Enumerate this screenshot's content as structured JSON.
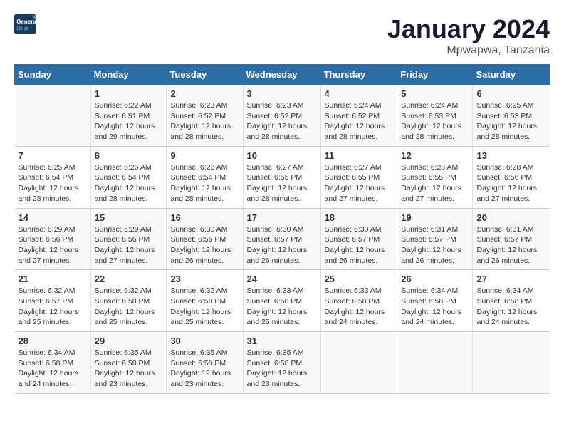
{
  "logo": {
    "line1": "General",
    "line2": "Blue"
  },
  "title": "January 2024",
  "subtitle": "Mpwapwa, Tanzania",
  "days_of_week": [
    "Sunday",
    "Monday",
    "Tuesday",
    "Wednesday",
    "Thursday",
    "Friday",
    "Saturday"
  ],
  "weeks": [
    [
      {
        "num": "",
        "sunrise": "",
        "sunset": "",
        "daylight": ""
      },
      {
        "num": "1",
        "sunrise": "Sunrise: 6:22 AM",
        "sunset": "Sunset: 6:51 PM",
        "daylight": "Daylight: 12 hours and 29 minutes."
      },
      {
        "num": "2",
        "sunrise": "Sunrise: 6:23 AM",
        "sunset": "Sunset: 6:52 PM",
        "daylight": "Daylight: 12 hours and 28 minutes."
      },
      {
        "num": "3",
        "sunrise": "Sunrise: 6:23 AM",
        "sunset": "Sunset: 6:52 PM",
        "daylight": "Daylight: 12 hours and 28 minutes."
      },
      {
        "num": "4",
        "sunrise": "Sunrise: 6:24 AM",
        "sunset": "Sunset: 6:52 PM",
        "daylight": "Daylight: 12 hours and 28 minutes."
      },
      {
        "num": "5",
        "sunrise": "Sunrise: 6:24 AM",
        "sunset": "Sunset: 6:53 PM",
        "daylight": "Daylight: 12 hours and 28 minutes."
      },
      {
        "num": "6",
        "sunrise": "Sunrise: 6:25 AM",
        "sunset": "Sunset: 6:53 PM",
        "daylight": "Daylight: 12 hours and 28 minutes."
      }
    ],
    [
      {
        "num": "7",
        "sunrise": "Sunrise: 6:25 AM",
        "sunset": "Sunset: 6:54 PM",
        "daylight": "Daylight: 12 hours and 28 minutes."
      },
      {
        "num": "8",
        "sunrise": "Sunrise: 6:26 AM",
        "sunset": "Sunset: 6:54 PM",
        "daylight": "Daylight: 12 hours and 28 minutes."
      },
      {
        "num": "9",
        "sunrise": "Sunrise: 6:26 AM",
        "sunset": "Sunset: 6:54 PM",
        "daylight": "Daylight: 12 hours and 28 minutes."
      },
      {
        "num": "10",
        "sunrise": "Sunrise: 6:27 AM",
        "sunset": "Sunset: 6:55 PM",
        "daylight": "Daylight: 12 hours and 28 minutes."
      },
      {
        "num": "11",
        "sunrise": "Sunrise: 6:27 AM",
        "sunset": "Sunset: 6:55 PM",
        "daylight": "Daylight: 12 hours and 27 minutes."
      },
      {
        "num": "12",
        "sunrise": "Sunrise: 6:28 AM",
        "sunset": "Sunset: 6:55 PM",
        "daylight": "Daylight: 12 hours and 27 minutes."
      },
      {
        "num": "13",
        "sunrise": "Sunrise: 6:28 AM",
        "sunset": "Sunset: 6:56 PM",
        "daylight": "Daylight: 12 hours and 27 minutes."
      }
    ],
    [
      {
        "num": "14",
        "sunrise": "Sunrise: 6:29 AM",
        "sunset": "Sunset: 6:56 PM",
        "daylight": "Daylight: 12 hours and 27 minutes."
      },
      {
        "num": "15",
        "sunrise": "Sunrise: 6:29 AM",
        "sunset": "Sunset: 6:56 PM",
        "daylight": "Daylight: 12 hours and 27 minutes."
      },
      {
        "num": "16",
        "sunrise": "Sunrise: 6:30 AM",
        "sunset": "Sunset: 6:56 PM",
        "daylight": "Daylight: 12 hours and 26 minutes."
      },
      {
        "num": "17",
        "sunrise": "Sunrise: 6:30 AM",
        "sunset": "Sunset: 6:57 PM",
        "daylight": "Daylight: 12 hours and 26 minutes."
      },
      {
        "num": "18",
        "sunrise": "Sunrise: 6:30 AM",
        "sunset": "Sunset: 6:57 PM",
        "daylight": "Daylight: 12 hours and 26 minutes."
      },
      {
        "num": "19",
        "sunrise": "Sunrise: 6:31 AM",
        "sunset": "Sunset: 6:57 PM",
        "daylight": "Daylight: 12 hours and 26 minutes."
      },
      {
        "num": "20",
        "sunrise": "Sunrise: 6:31 AM",
        "sunset": "Sunset: 6:57 PM",
        "daylight": "Daylight: 12 hours and 26 minutes."
      }
    ],
    [
      {
        "num": "21",
        "sunrise": "Sunrise: 6:32 AM",
        "sunset": "Sunset: 6:57 PM",
        "daylight": "Daylight: 12 hours and 25 minutes."
      },
      {
        "num": "22",
        "sunrise": "Sunrise: 6:32 AM",
        "sunset": "Sunset: 6:58 PM",
        "daylight": "Daylight: 12 hours and 25 minutes."
      },
      {
        "num": "23",
        "sunrise": "Sunrise: 6:32 AM",
        "sunset": "Sunset: 6:58 PM",
        "daylight": "Daylight: 12 hours and 25 minutes."
      },
      {
        "num": "24",
        "sunrise": "Sunrise: 6:33 AM",
        "sunset": "Sunset: 6:58 PM",
        "daylight": "Daylight: 12 hours and 25 minutes."
      },
      {
        "num": "25",
        "sunrise": "Sunrise: 6:33 AM",
        "sunset": "Sunset: 6:58 PM",
        "daylight": "Daylight: 12 hours and 24 minutes."
      },
      {
        "num": "26",
        "sunrise": "Sunrise: 6:34 AM",
        "sunset": "Sunset: 6:58 PM",
        "daylight": "Daylight: 12 hours and 24 minutes."
      },
      {
        "num": "27",
        "sunrise": "Sunrise: 6:34 AM",
        "sunset": "Sunset: 6:58 PM",
        "daylight": "Daylight: 12 hours and 24 minutes."
      }
    ],
    [
      {
        "num": "28",
        "sunrise": "Sunrise: 6:34 AM",
        "sunset": "Sunset: 6:58 PM",
        "daylight": "Daylight: 12 hours and 24 minutes."
      },
      {
        "num": "29",
        "sunrise": "Sunrise: 6:35 AM",
        "sunset": "Sunset: 6:58 PM",
        "daylight": "Daylight: 12 hours and 23 minutes."
      },
      {
        "num": "30",
        "sunrise": "Sunrise: 6:35 AM",
        "sunset": "Sunset: 6:58 PM",
        "daylight": "Daylight: 12 hours and 23 minutes."
      },
      {
        "num": "31",
        "sunrise": "Sunrise: 6:35 AM",
        "sunset": "Sunset: 6:58 PM",
        "daylight": "Daylight: 12 hours and 23 minutes."
      },
      {
        "num": "",
        "sunrise": "",
        "sunset": "",
        "daylight": ""
      },
      {
        "num": "",
        "sunrise": "",
        "sunset": "",
        "daylight": ""
      },
      {
        "num": "",
        "sunrise": "",
        "sunset": "",
        "daylight": ""
      }
    ]
  ]
}
